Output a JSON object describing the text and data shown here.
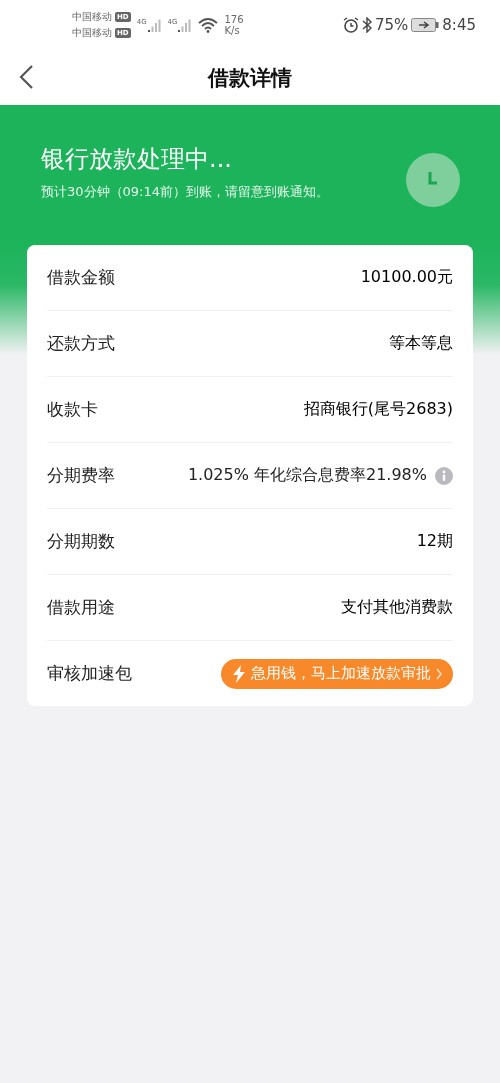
{
  "status_bar": {
    "carriers": [
      {
        "name": "中国移动",
        "badge": "HD"
      },
      {
        "name": "中国移动",
        "badge": "HD"
      }
    ],
    "signals": [
      "4G",
      "4G"
    ],
    "speed_value": "176",
    "speed_unit": "K/s",
    "battery": "75%",
    "time": "8:45"
  },
  "header": {
    "title": "借款详情"
  },
  "banner": {
    "title": "银行放款处理中...",
    "subtitle": "预计30分钟（09:14前）到账，请留意到账通知。"
  },
  "details": [
    {
      "kind": "text",
      "label": "借款金额",
      "value": "10100.00元"
    },
    {
      "kind": "text",
      "label": "还款方式",
      "value": "等本等息"
    },
    {
      "kind": "text",
      "label": "收款卡",
      "value": "招商银行(尾号2683)"
    },
    {
      "kind": "info",
      "label": "分期费率",
      "value": "1.025% 年化综合息费率21.98%"
    },
    {
      "kind": "text",
      "label": "分期期数",
      "value": "12期"
    },
    {
      "kind": "text",
      "label": "借款用途",
      "value": "支付其他消费款"
    },
    {
      "kind": "action",
      "label": "审核加速包",
      "value": "急用钱，马上加速放款审批"
    }
  ]
}
